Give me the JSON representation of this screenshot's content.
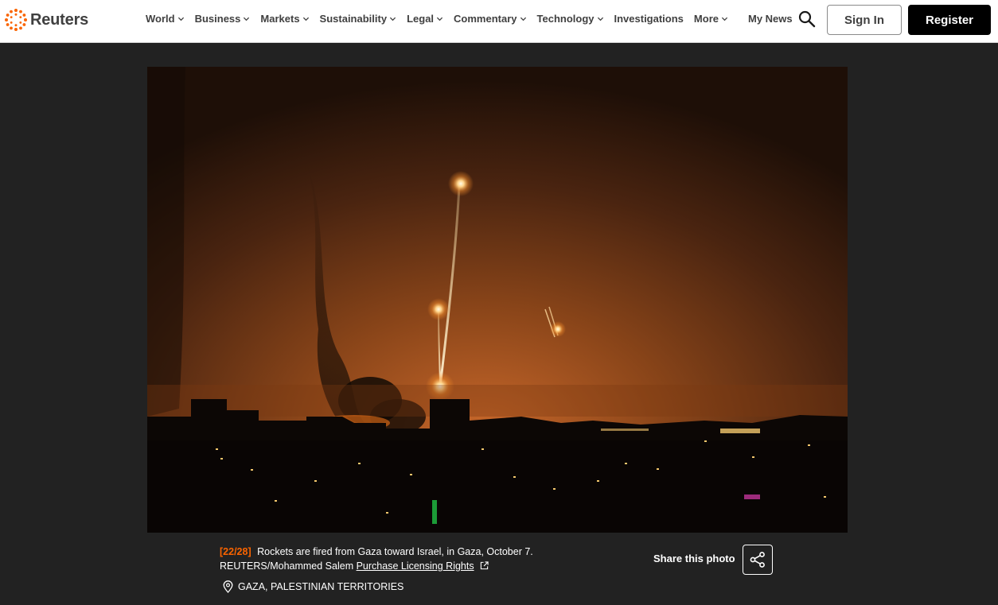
{
  "brand": {
    "name": "Reuters",
    "accent_color": "#fa6400"
  },
  "nav": {
    "items": [
      {
        "label": "World",
        "dropdown": true
      },
      {
        "label": "Business",
        "dropdown": true
      },
      {
        "label": "Markets",
        "dropdown": true
      },
      {
        "label": "Sustainability",
        "dropdown": true
      },
      {
        "label": "Legal",
        "dropdown": true
      },
      {
        "label": "Commentary",
        "dropdown": true
      },
      {
        "label": "Technology",
        "dropdown": true
      },
      {
        "label": "Investigations",
        "dropdown": false
      },
      {
        "label": "More",
        "dropdown": true
      }
    ],
    "my_news": "My News",
    "search_icon": "search-icon",
    "sign_in": "Sign In",
    "register": "Register"
  },
  "photo": {
    "counter": "[22/28]",
    "caption": "Rockets are fired from Gaza toward Israel, in Gaza, October 7. REUTERS/Mohammed Salem",
    "license_link": "Purchase Licensing Rights",
    "location": "GAZA, PALESTINIAN TERRITORIES",
    "share_label": "Share this photo",
    "share_icon": "share-icon"
  }
}
